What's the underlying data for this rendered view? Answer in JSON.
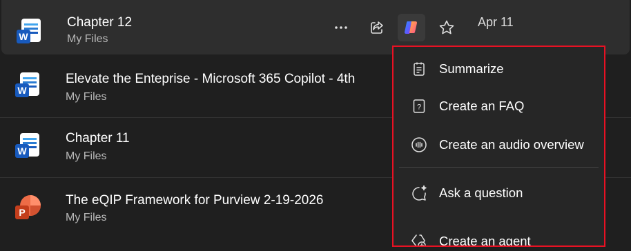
{
  "files": [
    {
      "title": "Chapter 12",
      "location": "My Files",
      "type": "word"
    },
    {
      "title": "Elevate the Enteprise - Microsoft 365 Copilot - 4th",
      "location": "My Files",
      "type": "word"
    },
    {
      "title": "Chapter 11",
      "location": "My Files",
      "type": "word"
    },
    {
      "title": "The eQIP Framework for Purview 2-19-2026",
      "location": "My Files",
      "type": "powerpoint"
    }
  ],
  "row_actions": {
    "more_icon": "more-horizontal-icon",
    "share_icon": "share-icon",
    "copilot_icon": "copilot-icon",
    "favorite_icon": "star-icon",
    "date": "Apr 11"
  },
  "copilot_menu": {
    "items": [
      {
        "label": "Summarize",
        "icon": "summarize-icon"
      },
      {
        "label": "Create an FAQ",
        "icon": "faq-icon"
      },
      {
        "label": "Create an audio overview",
        "icon": "audio-overview-icon"
      },
      {
        "label": "Ask a question",
        "icon": "ask-question-icon"
      },
      {
        "label": "Create an agent",
        "icon": "create-agent-icon"
      }
    ]
  },
  "colors": {
    "background": "#1f1f1f",
    "selected_row": "#2e2e2e",
    "highlight_border": "#e81123",
    "word_blue": "#185abd",
    "powerpoint_red": "#c43e1c"
  }
}
